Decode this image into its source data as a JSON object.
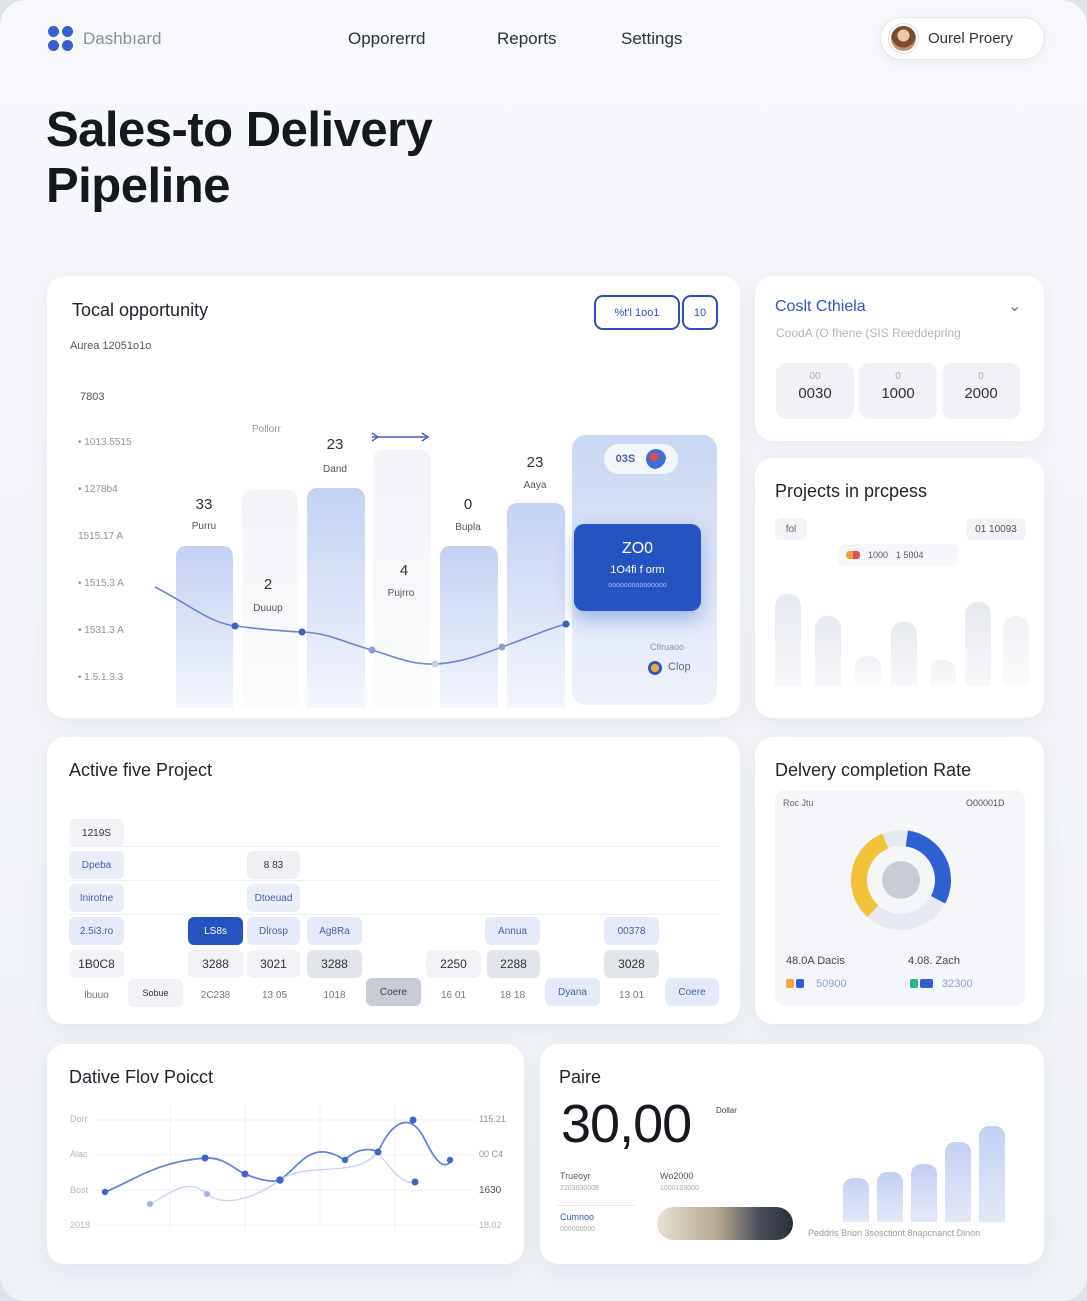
{
  "header": {
    "brand": "Dashbıard",
    "nav": [
      "Opporerrd",
      "Reports",
      "Settings"
    ],
    "user_name": "Ourel Proery"
  },
  "page_title_line1": "Sales-to Delivery",
  "page_title_line2": "Pipeline",
  "opportunity": {
    "title": "Tocal opportunity",
    "subtitle": "Aurea 12051o1o",
    "btn1": "%t'l 1oo1",
    "btn2": "10",
    "y_top": "7803",
    "y_labels": [
      "• 1013.5515",
      "• 1278b4",
      "1515.17 A",
      "• 1515.3 A",
      "• 1531.3 A",
      "• 1.5.1.3.3"
    ],
    "top_note": "Pollorr",
    "bars": [
      {
        "value": "33",
        "label": "Purru"
      },
      {
        "value": "2",
        "label": "Duuup"
      },
      {
        "value": "23",
        "label": "Dand"
      },
      {
        "value": "4",
        "label": "Pujrro"
      },
      {
        "value": "0",
        "label": "Bupla"
      },
      {
        "value": "23",
        "label": "Aaya"
      }
    ],
    "highlight_tag": "03S",
    "callout_value": "ZO0",
    "callout_line": "1O4fi f orm",
    "callout_sub": "ooooooooooooooo",
    "legend_label": "Clop",
    "legend_top": "Cfiruaoo",
    "colors": {
      "accent": "#2f56c6",
      "line": "#5f7fd4",
      "bar": "#c9d6f4"
    }
  },
  "cost": {
    "title": "Coslt Cthiela",
    "subtitle": "CoodA (O fhene (SIS Reeddeprlng",
    "stats": [
      {
        "top": "00",
        "value": "0030"
      },
      {
        "top": "0",
        "value": "1000"
      },
      {
        "top": "0",
        "value": "2000"
      }
    ]
  },
  "projects": {
    "title": "Projects in prcpess",
    "left_tag": "fol",
    "right_tag": "01 10093",
    "legend": [
      "1000",
      "1 5004"
    ]
  },
  "active": {
    "title": "Active five Project",
    "rows": [
      [
        "1219S"
      ],
      [
        "Dpeba",
        "8 83"
      ],
      [
        "Inirotne",
        "Dtoeuad"
      ],
      [
        "2.5i3.ro",
        "LS8s",
        "Dlrosp",
        "Ag8Ra",
        "Annua",
        "00378"
      ],
      [
        "1B0C8",
        "3288",
        "3021",
        "3288",
        "2250",
        "2288",
        "3028"
      ],
      [
        "lbuuo",
        "Sobue",
        "2C238",
        "13 05",
        "1018",
        "Coere",
        "16 01",
        "18 18",
        "Dyana",
        "13 01",
        "Coere"
      ]
    ]
  },
  "delivery": {
    "title": "Delvery completion Rate",
    "left_tag": "Roc Jtu",
    "right_tag": "O00001D",
    "legend": [
      {
        "label": "48.0A Dacis",
        "value": "50900"
      },
      {
        "label": "4.08. Zach",
        "value": "32300"
      }
    ],
    "colors": {
      "blue": "#2f5fd1",
      "yellow": "#f2c23a",
      "gray": "#e6e9f0"
    }
  },
  "dative": {
    "title": "Dative Flov Poicct",
    "y_left": [
      "Dorr",
      "Alac",
      "Bost",
      "2018"
    ],
    "y_right": [
      "115.21",
      "00 C4",
      "1630",
      "18.02"
    ]
  },
  "paid": {
    "title": "Paire",
    "big": "30,00",
    "sup": "Dollar",
    "label1": "Trueoyr",
    "sub1": "2203030008",
    "label2": "Wo2000",
    "sub2": "1000103000",
    "link": "Cumnoo",
    "link_sub": "000000000",
    "footer": "Peddrls Brion 3sosctiont 8napcnanct Dinon"
  }
}
